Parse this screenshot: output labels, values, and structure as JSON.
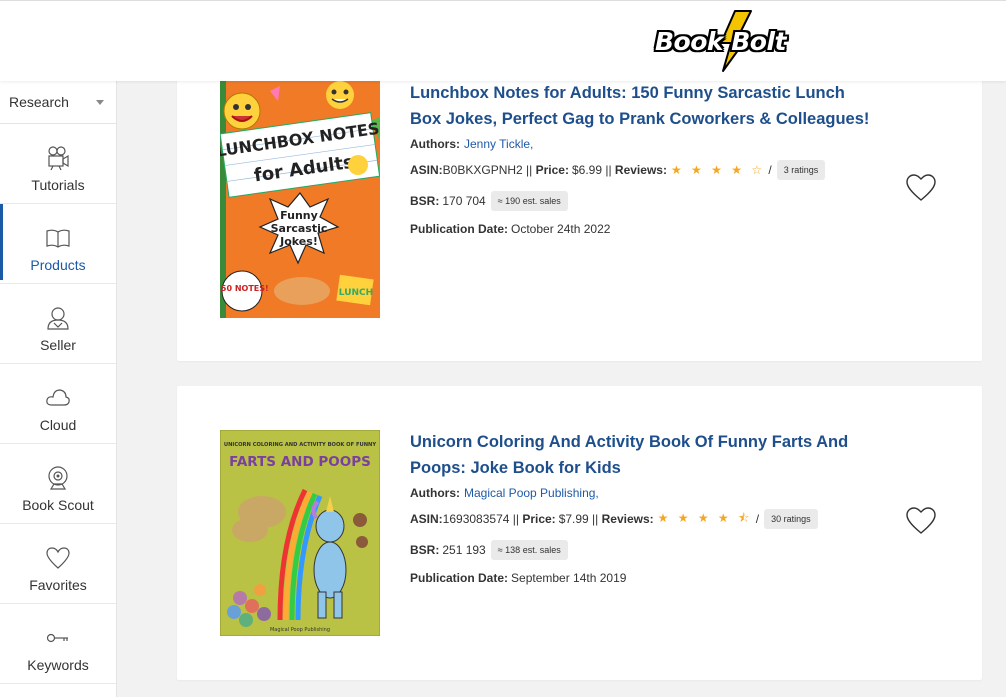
{
  "header": {
    "brand_name": "Book Bolt",
    "colors": {
      "bolt": "#f5c400",
      "outline": "#000000"
    }
  },
  "sidebar": {
    "select": {
      "value": "Research"
    },
    "items": [
      {
        "label": "Tutorials",
        "icon": "film-camera-icon",
        "active": false
      },
      {
        "label": "Products",
        "icon": "open-book-icon",
        "active": true
      },
      {
        "label": "Seller",
        "icon": "user-icon",
        "active": false
      },
      {
        "label": "Cloud",
        "icon": "cloud-icon",
        "active": false
      },
      {
        "label": "Book Scout",
        "icon": "webcam-icon",
        "active": false
      },
      {
        "label": "Favorites",
        "icon": "heart-icon",
        "active": false
      },
      {
        "label": "Keywords",
        "icon": "key-icon",
        "active": false
      }
    ]
  },
  "products": [
    {
      "title": "Lunchbox Notes for Adults: 150 Funny Sarcastic Lunch Box Jokes, Perfect Gag to Prank Coworkers & Colleagues!",
      "authors_label": "Authors:",
      "authors": "Jenny Tickle,",
      "asin_label": "ASIN:",
      "asin": "B0BKXGPNH2",
      "price_label": "Price:",
      "price": "$6.99",
      "reviews_label": "Reviews:",
      "rating": 4,
      "stars": "★ ★ ★ ★ ☆",
      "ratings_count": "3 ratings",
      "bsr_label": "BSR:",
      "bsr": "170 704",
      "est_sales": "≈ 190 est. sales",
      "pub_label": "Publication Date:",
      "pub_date": "October 24th 2022",
      "cover": {
        "line1": "LUNCHBOX NOTES",
        "line2": "for Adults",
        "line3": "Funny",
        "line4": "Sarcastic",
        "line5": "Jokes!",
        "corner": "150 NOTES!",
        "tag": "LUNCH"
      }
    },
    {
      "title": "Unicorn Coloring And Activity Book Of Funny Farts And Poops: Joke Book for Kids",
      "authors_label": "Authors:",
      "authors": "Magical Poop Publishing,",
      "asin_label": "ASIN:",
      "asin": "1693083574",
      "price_label": "Price:",
      "price": "$7.99",
      "reviews_label": "Reviews:",
      "rating": 4.5,
      "stars": "★ ★ ★ ★ ⯪",
      "ratings_count": "30 ratings",
      "bsr_label": "BSR:",
      "bsr": "251 193",
      "est_sales": "≈ 138 est. sales",
      "pub_label": "Publication Date:",
      "pub_date": "September 14th 2019",
      "cover": {
        "line1": "UNICORN COLORING AND ACTIVITY BOOK OF FUNNY",
        "line2": "FARTS AND POOPS",
        "footer": "Magical Poop Publishing"
      }
    }
  ]
}
